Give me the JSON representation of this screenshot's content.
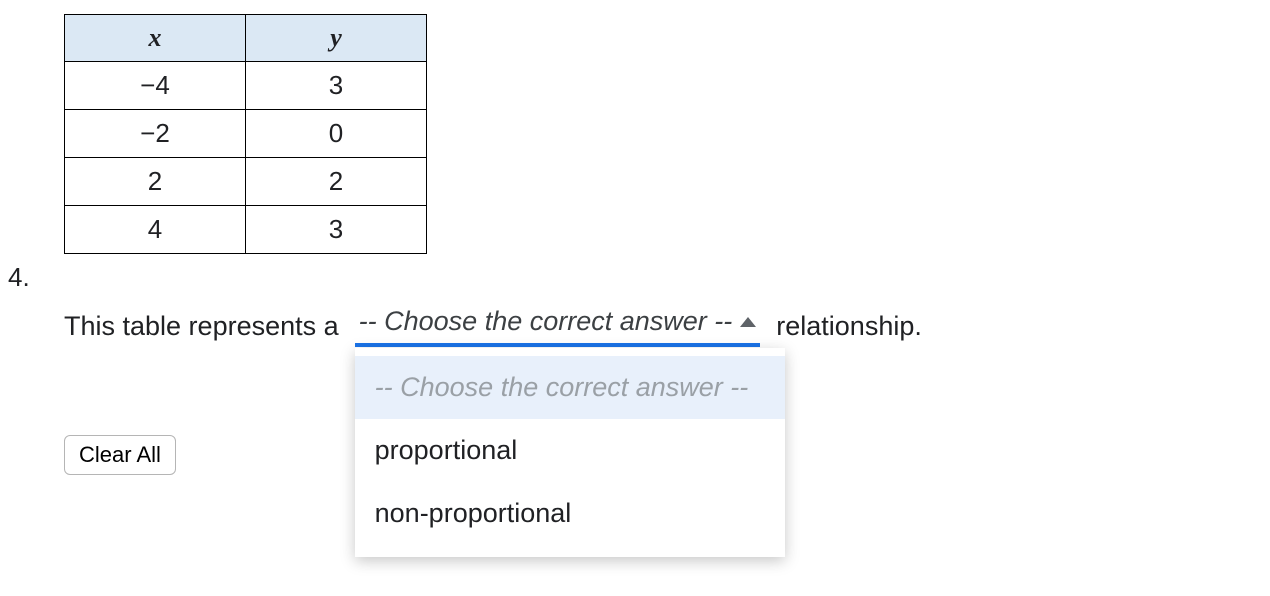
{
  "question_number": "4.",
  "table": {
    "headers": {
      "x": "x",
      "y": "y"
    },
    "rows": [
      {
        "x": "−4",
        "y": "3"
      },
      {
        "x": "−2",
        "y": "0"
      },
      {
        "x": "2",
        "y": "2"
      },
      {
        "x": "4",
        "y": "3"
      }
    ]
  },
  "sentence": {
    "before": "This table represents a",
    "after": "relationship."
  },
  "dropdown": {
    "selected": "-- Choose the correct answer --",
    "placeholder": "-- Choose the correct answer --",
    "options": [
      "proportional",
      "non-proportional"
    ]
  },
  "clear_button": "Clear All"
}
